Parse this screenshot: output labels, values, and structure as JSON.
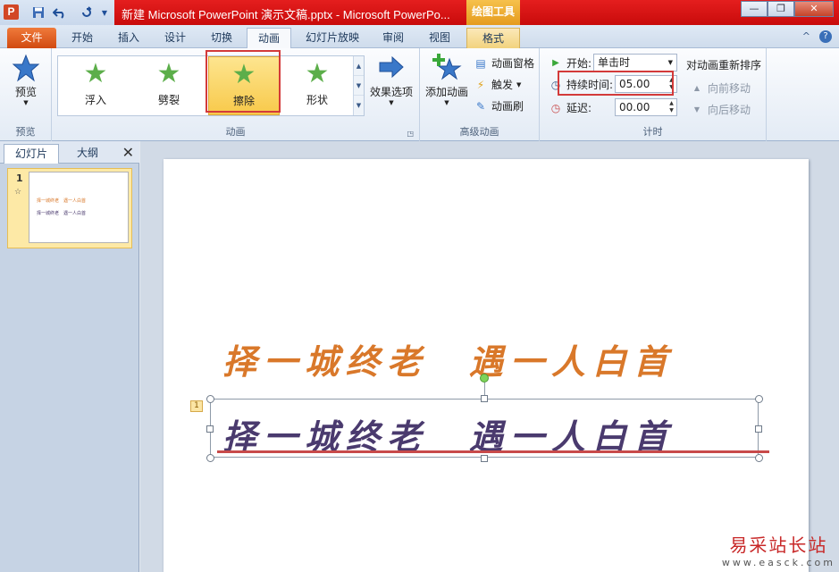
{
  "titlebar": {
    "app_icon": "P",
    "title": "新建 Microsoft PowerPoint 演示文稿.pptx - Microsoft PowerPo...",
    "context_tools": "绘图工具",
    "qat": [
      "save-icon",
      "undo-icon",
      "redo-icon",
      "qat-menu-icon"
    ],
    "win_min": "—",
    "win_max": "❐",
    "win_close": "✕"
  },
  "tabs": {
    "file": "文件",
    "items": [
      "开始",
      "插入",
      "设计",
      "切换",
      "动画",
      "幻灯片放映",
      "审阅",
      "视图"
    ],
    "format": "格式",
    "help_icon": "?",
    "collapse_icon": "^"
  },
  "ribbon": {
    "preview": {
      "label": "预览",
      "group": "预览"
    },
    "animation": {
      "group": "动画",
      "items": [
        "浮入",
        "劈裂",
        "擦除",
        "形状"
      ],
      "selected": "擦除",
      "effect_options": "效果选项"
    },
    "advanced": {
      "group": "高级动画",
      "add_animation": "添加动画",
      "pane": "动画窗格",
      "trigger": "触发",
      "painter": "动画刷"
    },
    "timing": {
      "group": "计时",
      "start_label": "开始:",
      "start_value": "单击时",
      "duration_label": "持续时间:",
      "duration_value": "05.00",
      "delay_label": "延迟:",
      "delay_value": "00.00"
    },
    "reorder": {
      "title": "对动画重新排序",
      "forward": "向前移动",
      "backward": "向后移动"
    }
  },
  "left_pane": {
    "tab_slides": "幻灯片",
    "tab_outline": "大纲",
    "close": "✕",
    "slide_number": "1",
    "slide_anim_mark": "☆"
  },
  "slide": {
    "line1": "择一城终老　遇一人白首",
    "line2": "择一城终老　遇一人白首",
    "anim_tag": "1",
    "color_line1": "#d9782a",
    "color_line2": "#4a3a6e"
  },
  "thumbnail": {
    "line1": "择一城终老　遇一人白首",
    "line2": "择一城终老　遇一人白首"
  },
  "watermark": {
    "line1": "易采站长站",
    "line2": "www.easck.com"
  }
}
